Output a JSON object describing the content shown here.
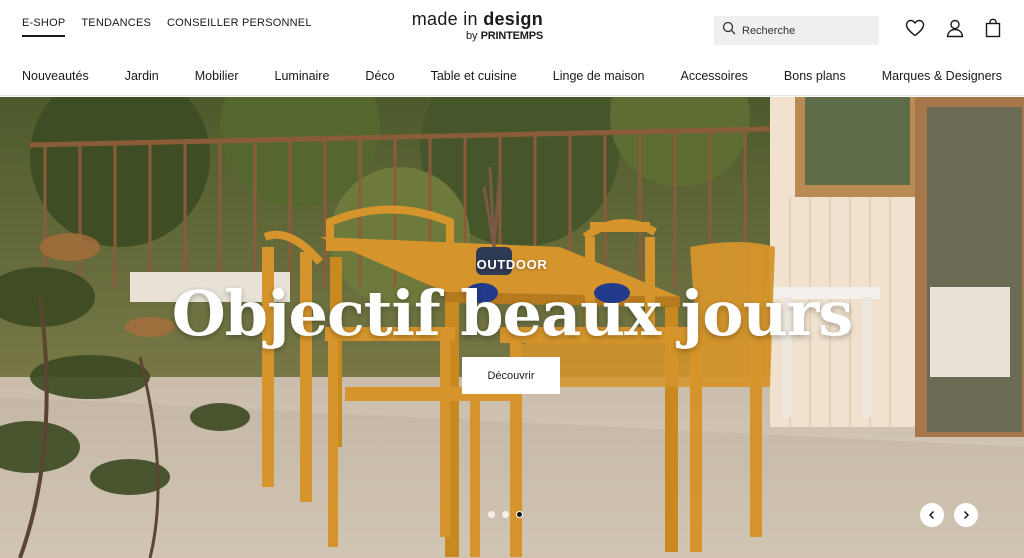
{
  "top_links": [
    {
      "label": "E-SHOP",
      "active": true
    },
    {
      "label": "TENDANCES",
      "active": false
    },
    {
      "label": "CONSEILLER PERSONNEL",
      "active": false
    }
  ],
  "logo": {
    "line1_a": "made in ",
    "line1_b": "design",
    "line2_a": "by ",
    "line2_b": "PRINTEMPS"
  },
  "search": {
    "placeholder": "Recherche"
  },
  "header_icons": [
    "heart-icon",
    "user-icon",
    "bag-icon"
  ],
  "nav": [
    "Nouveautés",
    "Jardin",
    "Mobilier",
    "Luminaire",
    "Déco",
    "Table et cuisine",
    "Linge de maison",
    "Accessoires",
    "Bons plans",
    "Marques & Designers"
  ],
  "hero": {
    "overline": "OUTDOOR",
    "title": "Objectif beaux jours",
    "cta": "Découvrir",
    "slide_count": 3,
    "active_slide": 3
  },
  "colors": {
    "furniture": "#d6952c",
    "text": "#1a1a1a",
    "search_bg": "#efefef"
  }
}
